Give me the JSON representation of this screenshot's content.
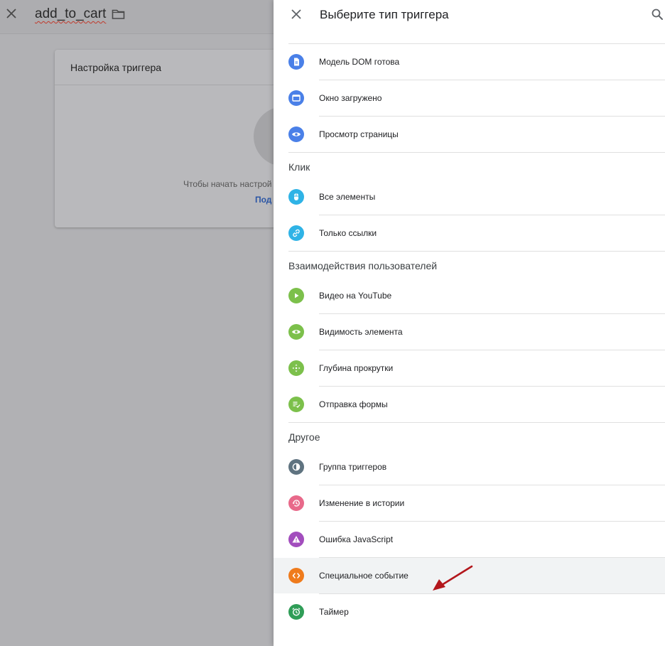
{
  "background": {
    "tag_name": "add_to_cart",
    "card_title": "Настройка триггера",
    "card_hint": "Чтобы начать настрой",
    "card_link": "Под"
  },
  "panel": {
    "title": "Выберите тип триггера"
  },
  "groups": [
    {
      "heading": "",
      "items": [
        {
          "label": "Модель DOM готова",
          "icon": "document-icon",
          "color": "#4a80e8"
        },
        {
          "label": "Окно загружено",
          "icon": "window-icon",
          "color": "#4a80e8"
        },
        {
          "label": "Просмотр страницы",
          "icon": "eye-icon",
          "color": "#4a80e8"
        }
      ]
    },
    {
      "heading": "Клик",
      "items": [
        {
          "label": "Все элементы",
          "icon": "mouse-icon",
          "color": "#2fb3e6"
        },
        {
          "label": "Только ссылки",
          "icon": "link-icon",
          "color": "#2fb3e6"
        }
      ]
    },
    {
      "heading": "Взаимодействия пользователей",
      "items": [
        {
          "label": "Видео на YouTube",
          "icon": "play-icon",
          "color": "#7cc04b"
        },
        {
          "label": "Видимость элемента",
          "icon": "eye-icon",
          "color": "#7cc04b"
        },
        {
          "label": "Глубина прокрутки",
          "icon": "move-icon",
          "color": "#7cc04b"
        },
        {
          "label": "Отправка формы",
          "icon": "form-check-icon",
          "color": "#7cc04b"
        }
      ]
    },
    {
      "heading": "Другое",
      "items": [
        {
          "label": "Группа триггеров",
          "icon": "group-icon",
          "color": "#5f7380"
        },
        {
          "label": "Изменение в истории",
          "icon": "history-icon",
          "color": "#e8698a"
        },
        {
          "label": "Ошибка JavaScript",
          "icon": "warning-icon",
          "color": "#a24dbd"
        },
        {
          "label": "Специальное событие",
          "icon": "code-icon",
          "color": "#ef7b1c",
          "highlight": true
        },
        {
          "label": "Таймер",
          "icon": "alarm-icon",
          "color": "#2f9d57"
        }
      ]
    }
  ],
  "colors": {
    "arrow": "#b3171c"
  }
}
